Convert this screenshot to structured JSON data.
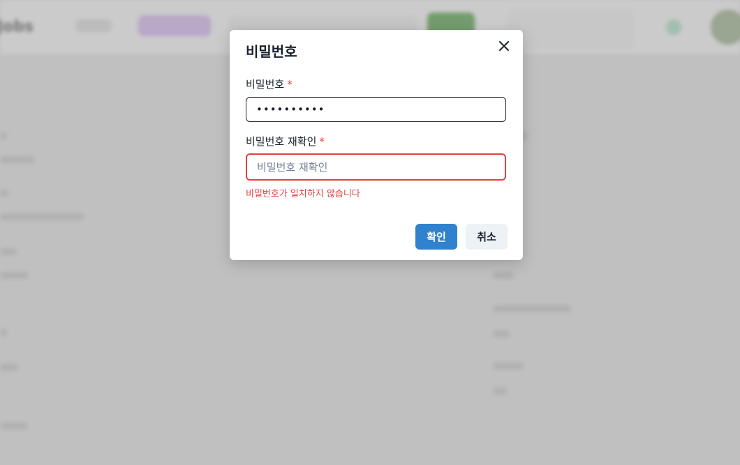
{
  "background": {
    "logo_text": "Jobs"
  },
  "dialog": {
    "title": "비밀번호",
    "close_icon": "close-icon",
    "password_label": "비밀번호",
    "password_value": "••••••••••",
    "confirm_label": "비밀번호 재확인",
    "required_mark": "*",
    "confirm_placeholder": "비밀번호 재확인",
    "confirm_value": "",
    "error_message": "비밀번호가 일치하지 않습니다",
    "confirm_button": "확인",
    "cancel_button": "취소"
  },
  "colors": {
    "primary": "#3182ce",
    "error": "#e53e3e",
    "text": "#1a202c",
    "cancel_bg": "#edf2f7"
  }
}
